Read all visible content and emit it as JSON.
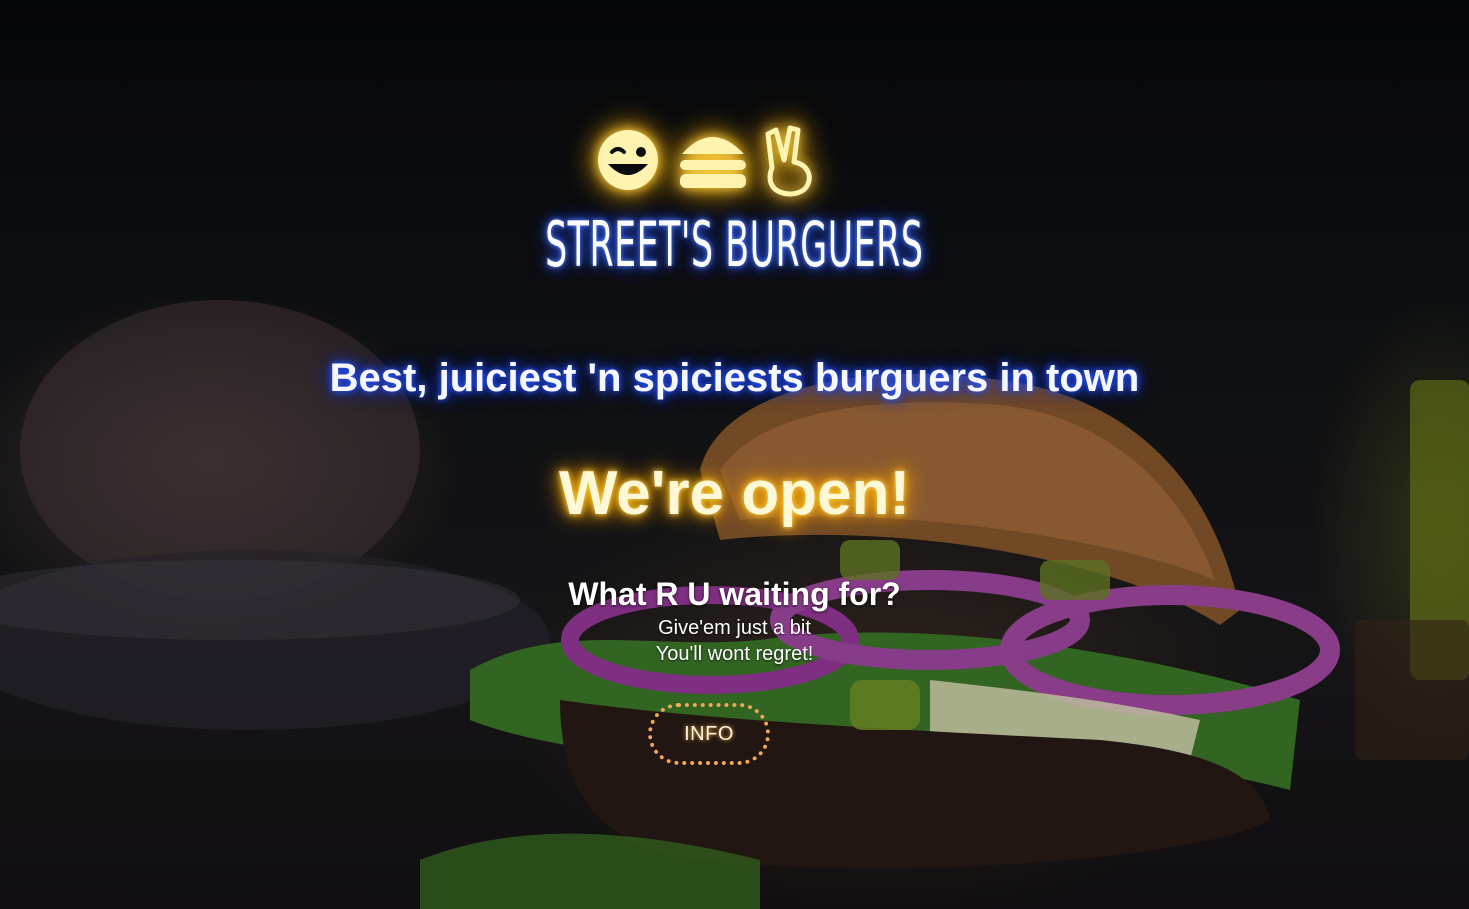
{
  "brand": {
    "name": "STREET'S BURGUERS",
    "icons": [
      "winking-face-icon",
      "burger-icon",
      "victory-hand-icon"
    ]
  },
  "hero": {
    "tagline": "Best, juiciest 'n spiciests burguers in town",
    "status": "We're open!",
    "question": "What R U waiting for?",
    "line1": "Give'em just a bit",
    "line2": "You'll wont regret!",
    "info_label": "INFO"
  },
  "colors": {
    "neon_blue": "#2f5bff",
    "neon_yellow": "#ffd54a",
    "button_border": "#f0a85a"
  }
}
